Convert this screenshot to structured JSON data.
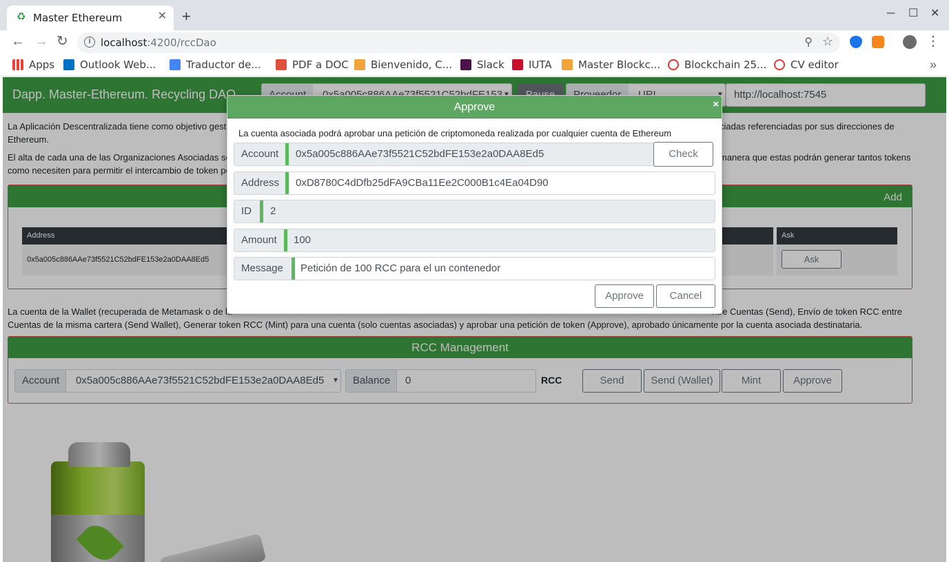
{
  "browser": {
    "tab_title": "Master Ethereum",
    "url_host": "localhost",
    "url_rest": ":4200/rccDao",
    "bookmarks": [
      {
        "label": "Apps",
        "color": "#e94235"
      },
      {
        "label": "Outlook Web...",
        "color": "#0072c6"
      },
      {
        "label": "Traductor de...",
        "color": "#4285f4"
      },
      {
        "label": "PDF a DOC",
        "color": "#e0513d"
      },
      {
        "label": "Bienvenido, C...",
        "color": "#f2a33a"
      },
      {
        "label": "Slack",
        "color": "#4a154b"
      },
      {
        "label": "IUTA",
        "color": "#c8102e"
      },
      {
        "label": "Master Blockc...",
        "color": "#f2a33a"
      },
      {
        "label": "Blockchain 25...",
        "color": "#d63a2f"
      },
      {
        "label": "CV editor",
        "color": "#e53935"
      }
    ]
  },
  "header": {
    "title": "Dapp. Master-Ethereum. Recycling DAO",
    "account_label": "Account",
    "account_value": "0x5a005c886AAe73f5521C52bdFE153",
    "pause_label": "Pause",
    "provider_label": "Proveedor",
    "provider_value": "URL",
    "provider_url": "http://localhost:7545"
  },
  "intro": {
    "para1_start": "La Aplicación Descentralizada tiene como objetivo gesti",
    "para1_end": "ciadas referenciadas por sus direcciones de",
    "para1_line2": "Ethereum.",
    "para2_start": "El alta de cada una de las Organizaciones Asociadas so",
    "para2_end": "manera que estas podrán generar tantos tokens",
    "para2_line2": "como necesiten para permitir el intercambio de token po"
  },
  "assoc_panel": {
    "add_label": "Add",
    "col_address": "Address",
    "col_ask": "Ask",
    "row_address": "0x5a005c886AAe73f5521C52bdFE153e2a0DAA8Ed5",
    "ask_button": "Ask"
  },
  "wallet_text": {
    "line1_start": "La cuenta de la Wallet (recuperada de Metamask o de la",
    "line1_end": "ntre Cuentas (Send), Envío de token RCC entre",
    "line2": "Cuentas de la misma cartera (Send Wallet), Generar token RCC (Mint) para una cuenta (solo cuentas asociadas) y aprobar una petición de token (Approve), aprobado únicamente por la cuenta asociada destinataria."
  },
  "rcc": {
    "title": "RCC Management",
    "account_label": "Account",
    "account_value": "0x5a005c886AAe73f5521C52bdFE153e2a0DAA8Ed5",
    "balance_label": "Balance",
    "balance_value": "0",
    "unit": "RCC",
    "send": "Send",
    "send_wallet": "Send (Wallet)",
    "mint": "Mint",
    "approve": "Approve"
  },
  "modal": {
    "title": "Approve",
    "close": "×",
    "description": "La cuenta asociada podrá aprobar una petición de criptomoneda realizada por cualquier cuenta de Ethereum",
    "account_label": "Account",
    "account_value": "0x5a005c886AAe73f5521C52bdFE153e2a0DAA8Ed5",
    "check_button": "Check",
    "address_label": "Address",
    "address_value": "0xD8780C4dDfb25dFA9CBa11Ee2C000B1c4Ea04D90",
    "id_label": "ID",
    "id_value": "2",
    "amount_label": "Amount",
    "amount_value": "100",
    "message_label": "Message",
    "message_value": "Petición de 100 RCC para el un contenedor",
    "approve_button": "Approve",
    "cancel_button": "Cancel"
  }
}
